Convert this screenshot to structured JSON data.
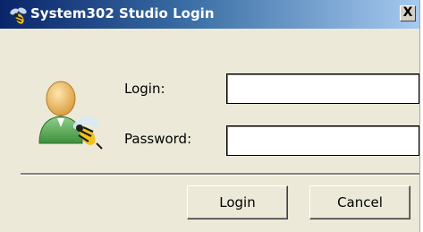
{
  "window": {
    "title": "System302 Studio Login",
    "close_label": "X"
  },
  "form": {
    "login_label": "Login:",
    "login_value": "",
    "password_label": "Password:",
    "password_value": ""
  },
  "buttons": {
    "login_label": "Login",
    "cancel_label": "Cancel"
  },
  "icons": {
    "app": "wasp-icon",
    "user": "user-with-wasp-icon",
    "close": "close-icon"
  },
  "colors": {
    "titlebar_start": "#0a246a",
    "titlebar_end": "#a6caf0",
    "dialog_bg": "#ece9d8"
  }
}
